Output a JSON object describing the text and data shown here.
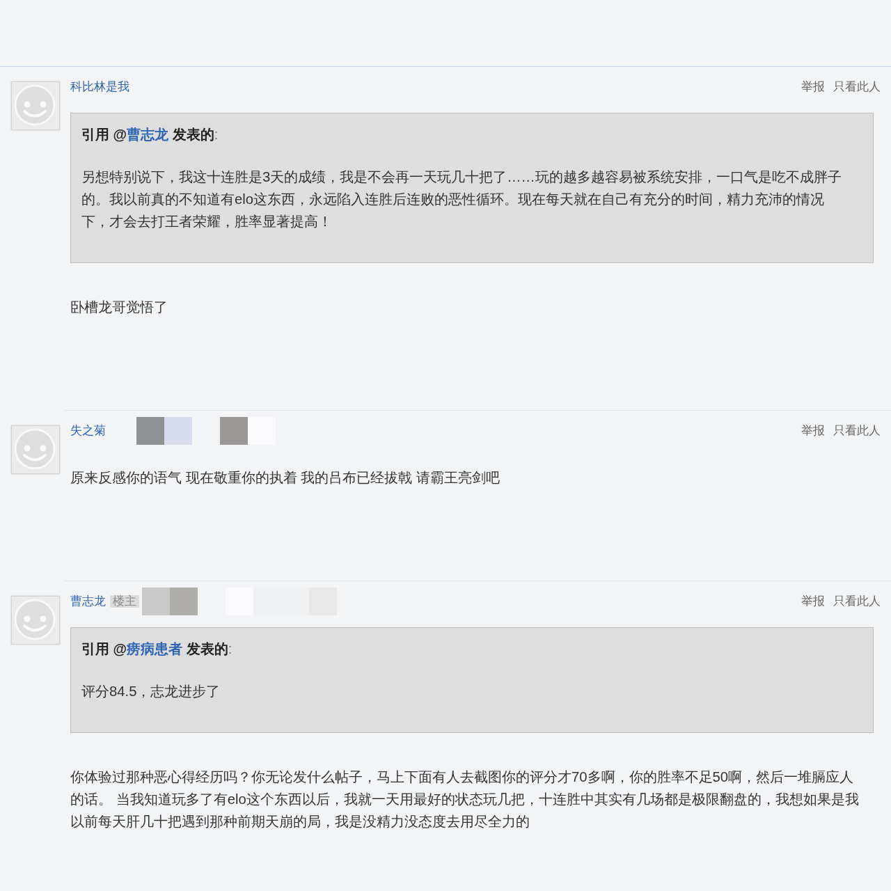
{
  "posts": [
    {
      "author": "科比林是我",
      "actions": [
        "举报",
        "只看此人"
      ],
      "quote": {
        "lead": "引用 @",
        "author": "曹志龙",
        "tail": "发表的",
        "colon": ":",
        "text": "另想特别说下，我这十连胜是3天的成绩，我是不会再一天玩几十把了……玩的越多越容易被系统安排，一口气是吃不成胖子的。我以前真的不知道有elo这东西，永远陷入连胜后连败的恶性循环。现在每天就在自己有充分的时间，精力充沛的情况下，才会去打王者荣耀，胜率显著提高！"
      },
      "text": "卧槽龙哥觉悟了"
    },
    {
      "author": "失之菊",
      "actions": [
        "举报",
        "只看此人"
      ],
      "redaction_tiles": [
        {
          "kind": "blank"
        },
        {
          "kind": "tile",
          "color": "#8f9192"
        },
        {
          "kind": "tile",
          "color": "#d9dcec"
        },
        {
          "kind": "blank"
        },
        {
          "kind": "tile",
          "color": "#9b9796"
        },
        {
          "kind": "tile",
          "color": "#fafafc"
        }
      ],
      "text": "原来反感你的语气 现在敬重你的执着 我的吕布已经拔戟 请霸王亮剑吧"
    },
    {
      "author": "曹志龙",
      "badge": "楼主",
      "actions": [
        "举报",
        "只看此人"
      ],
      "redaction_tiles": [
        {
          "kind": "tile",
          "color": "#c9c9c9"
        },
        {
          "kind": "tile",
          "color": "#b0aeab"
        },
        {
          "kind": "blank"
        },
        {
          "kind": "tile",
          "color": "#fafafc"
        },
        {
          "kind": "tile",
          "color": "#eff0f2"
        },
        {
          "kind": "tile",
          "color": "#eff0f2"
        },
        {
          "kind": "tile",
          "color": "#e8e8e9"
        }
      ],
      "quote": {
        "lead": "引用 @",
        "author": "痨病患者",
        "tail": "发表的",
        "colon": ":",
        "text": "评分84.5，志龙进步了"
      },
      "text": "你体验过那种恶心得经历吗？你无论发什么帖子，马上下面有人去截图你的评分才70多啊，你的胜率不足50啊，然后一堆膈应人的话。 当我知道玩多了有elo这个东西以后，我就一天用最好的状态玩几把，十连胜中其实有几场都是极限翻盘的，我想如果是我以前每天肝几十把遇到那种前期天崩的局，我是没精力没态度去用尽全力的"
    }
  ]
}
